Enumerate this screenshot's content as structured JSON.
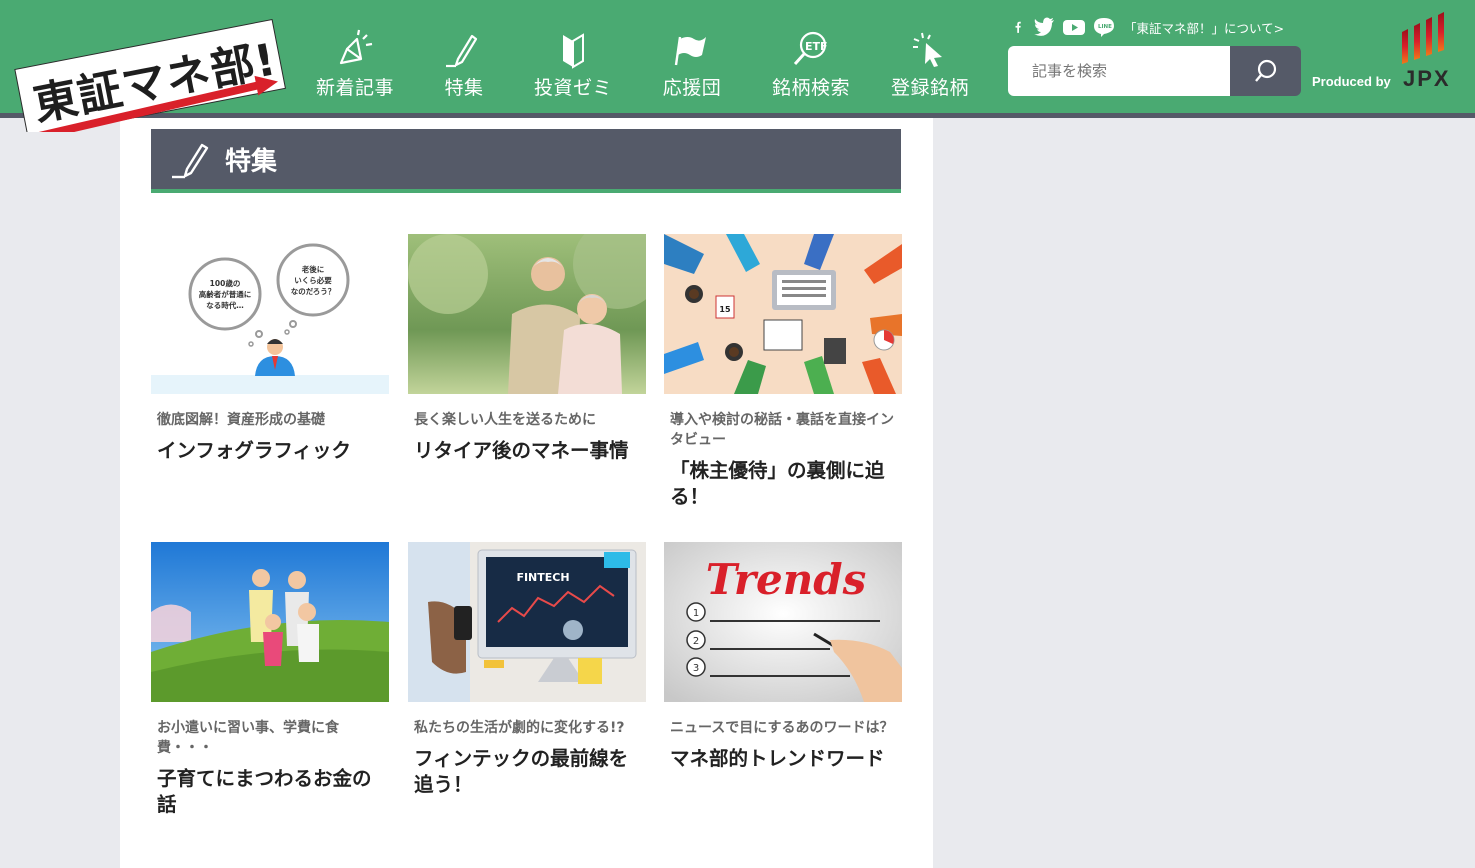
{
  "logo": {
    "text": "東証マネ部!"
  },
  "nav": [
    {
      "label": "新着記事",
      "icon": "megaphone-icon"
    },
    {
      "label": "特集",
      "icon": "pen-icon"
    },
    {
      "label": "投資ゼミ",
      "icon": "beginner-mark-icon"
    },
    {
      "label": "応援団",
      "icon": "flag-icon"
    },
    {
      "label": "銘柄検索",
      "icon": "etf-search-icon"
    },
    {
      "label": "登録銘柄",
      "icon": "click-pointer-icon"
    }
  ],
  "social": {
    "icons": [
      "facebook-icon",
      "twitter-icon",
      "youtube-icon",
      "line-icon"
    ],
    "line_text": "LINE",
    "about_label": "「東証マネ部！」について>"
  },
  "search": {
    "placeholder": "記事を検索"
  },
  "produced_by": "Produced by",
  "brand": "JPX",
  "section": {
    "title": "特集",
    "icon": "pen-icon"
  },
  "illustration_texts": {
    "bubble1": [
      "100歳の",
      "高齢者が普通に",
      "なる時代…"
    ],
    "bubble2": [
      "老後に",
      "いくら必要",
      "なのだろう？"
    ],
    "calendar_day": "15",
    "fintech": "FINTECH",
    "trends": "Trends"
  },
  "cards": [
    {
      "category": "徹底図解！資産形成の基礎",
      "title": "インフォグラフィック",
      "image": "infographic-illustration"
    },
    {
      "category": "長く楽しい人生を送るために",
      "title": "リタイア後のマネー事情",
      "image": "senior-couple-photo"
    },
    {
      "category": "導入や検討の秘話・裏話を直接インタビュー",
      "title": "「株主優待」の裏側に迫る！",
      "image": "office-desk-photo"
    },
    {
      "category": "お小遣いに習い事、学費に食費・・・",
      "title": "子育てにまつわるお金の話",
      "image": "family-park-photo"
    },
    {
      "category": "私たちの生活が劇的に変化する!?",
      "title": "フィンテックの最前線を追う！",
      "image": "fintech-monitor-photo"
    },
    {
      "category": "ニュースで目にするあのワードは？",
      "title": "マネ部的トレンドワード",
      "image": "trends-list-photo"
    }
  ],
  "colors": {
    "brand_green": "#4aaa72",
    "header_gray": "#555a68",
    "page_bg": "#e9eaee"
  }
}
